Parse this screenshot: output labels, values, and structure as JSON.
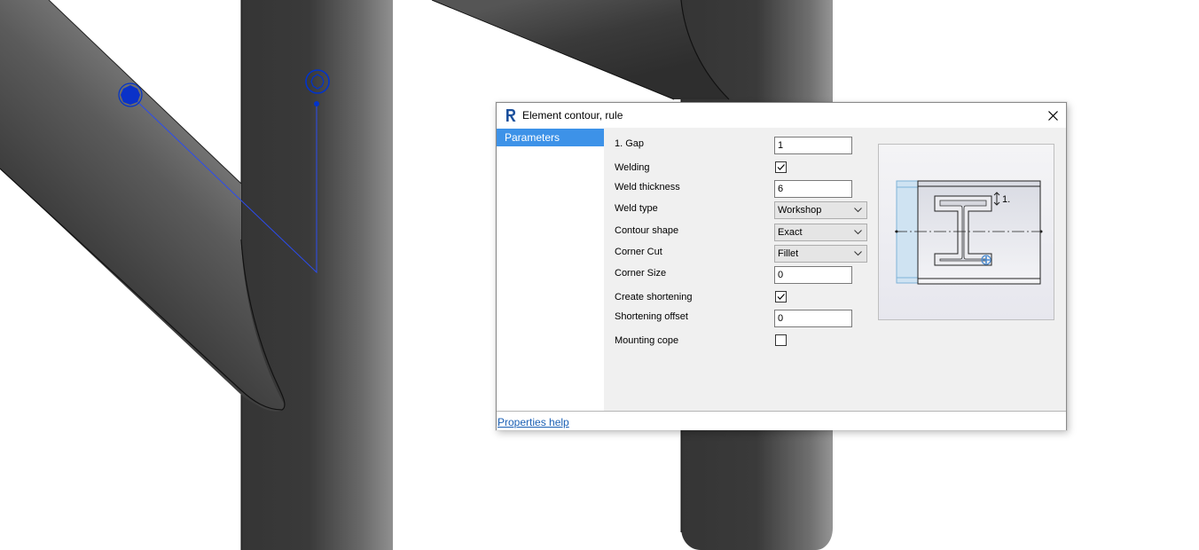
{
  "dialog": {
    "title": "Element contour, rule",
    "app_icon": "revit-r-logo",
    "close_icon": "close-icon"
  },
  "sidebar": {
    "items": [
      {
        "label": "Parameters",
        "selected": true
      }
    ]
  },
  "form": {
    "gap": {
      "label": "1. Gap",
      "value": "1"
    },
    "welding": {
      "label": "Welding",
      "checked": true
    },
    "weld_thickness": {
      "label": "Weld thickness",
      "value": "6"
    },
    "weld_type": {
      "label": "Weld type",
      "value": "Workshop"
    },
    "contour_shape": {
      "label": "Contour shape",
      "value": "Exact"
    },
    "corner_cut": {
      "label": "Corner Cut",
      "value": "Fillet"
    },
    "corner_size": {
      "label": "Corner Size",
      "value": "0"
    },
    "create_shortening": {
      "label": "Create shortening",
      "checked": true
    },
    "shortening_offset": {
      "label": "Shortening offset",
      "value": "0"
    },
    "mounting_cope": {
      "label": "Mounting cope",
      "checked": false
    }
  },
  "preview": {
    "gap_marker": "1."
  },
  "footer": {
    "help_link": "Properties help"
  },
  "colors": {
    "accent": "#3d92e8",
    "link": "#1a5fb4",
    "control_point": "#0033cc",
    "beam_dark": "#3a3a3a"
  }
}
